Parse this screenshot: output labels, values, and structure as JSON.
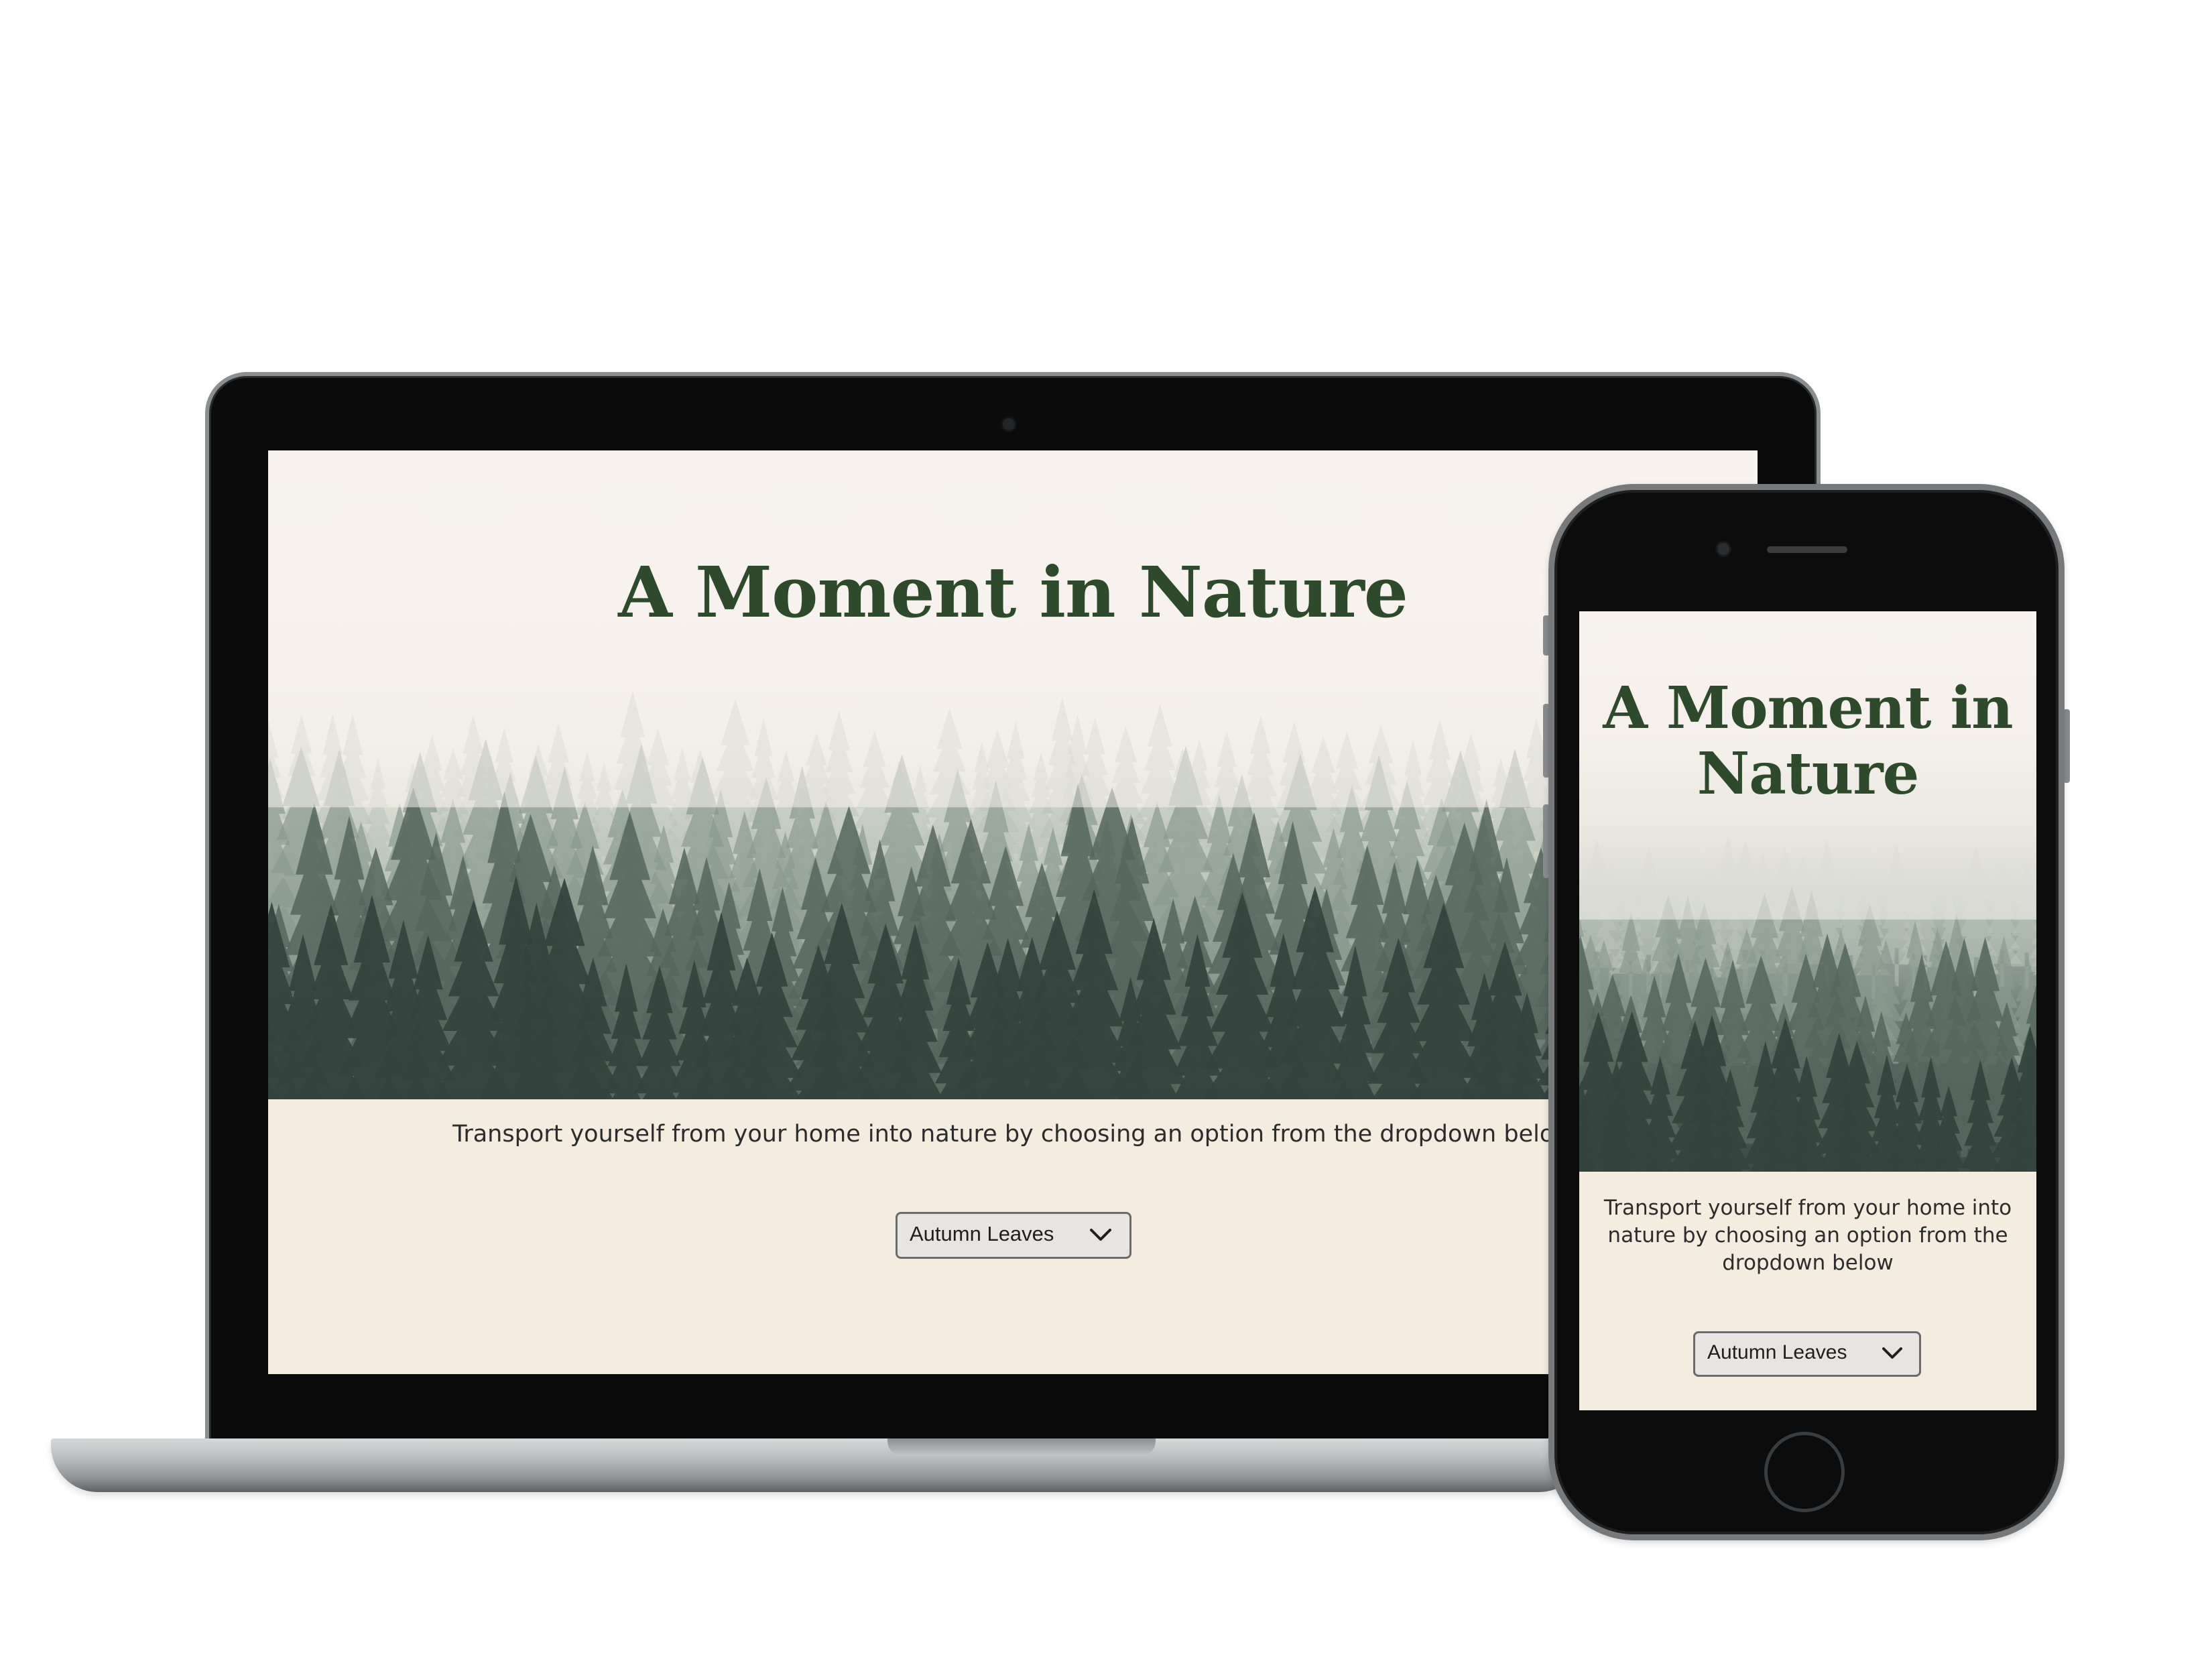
{
  "page": {
    "title": "A Moment in Nature",
    "description": "Transport yourself from your home into nature by choosing an option from the dropdown below",
    "scene_select": {
      "selected": "Autumn Leaves",
      "icon": "chevron-down-icon"
    }
  },
  "phone": {
    "title_line1": "A Moment in",
    "title_line2": "Nature",
    "description_line1": "Transport yourself from your home into",
    "description_line2": "nature by choosing an option from the",
    "description_line3": "dropdown below"
  },
  "colors": {
    "title": "#2d4a2a",
    "page_background": "#f3ecdf",
    "fog": "#f8f4ef",
    "trees_dark": "#34453f",
    "device_frame": "#0b0b0b",
    "select_background": "#e6e5e2"
  }
}
